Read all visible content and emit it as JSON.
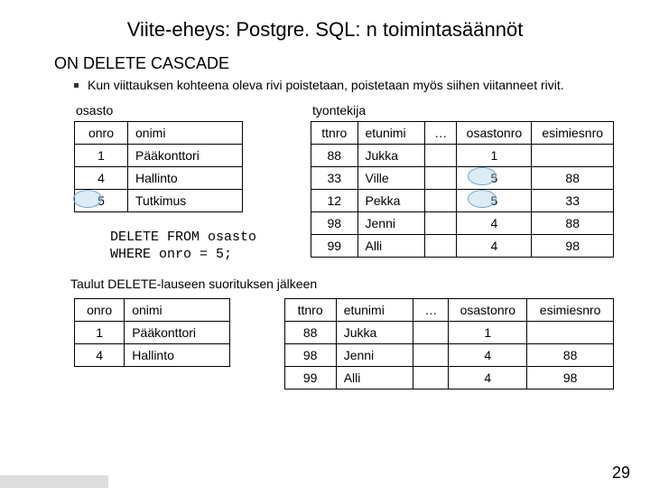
{
  "title": "Viite-eheys: Postgre. SQL: n toimintasäännöt",
  "subtitle": "ON DELETE CASCADE",
  "bullet": "Kun viittauksen kohteena oleva rivi poistetaan, poistetaan myös siihen viitanneet rivit.",
  "labels": {
    "osasto": "osasto",
    "tyontekija": "tyontekija",
    "after": "Taulut DELETE-lauseen suorituksen jälkeen"
  },
  "osasto_before": {
    "headers": [
      "onro",
      "onimi"
    ],
    "rows": [
      [
        "1",
        "Pääkonttori"
      ],
      [
        "4",
        "Hallinto"
      ],
      [
        "5",
        "Tutkimus"
      ]
    ]
  },
  "tyontekija_before": {
    "headers": [
      "ttnro",
      "etunimi",
      "…",
      "osastonro",
      "esimiesnro"
    ],
    "rows": [
      [
        "88",
        "Jukka",
        "",
        "1",
        ""
      ],
      [
        "33",
        "Ville",
        "",
        "5",
        "88"
      ],
      [
        "12",
        "Pekka",
        "",
        "5",
        "33"
      ],
      [
        "98",
        "Jenni",
        "",
        "4",
        "88"
      ],
      [
        "99",
        "Alli",
        "",
        "4",
        "98"
      ]
    ]
  },
  "sql": "DELETE FROM osasto\nWHERE onro = 5;",
  "osasto_after": {
    "headers": [
      "onro",
      "onimi"
    ],
    "rows": [
      [
        "1",
        "Pääkonttori"
      ],
      [
        "4",
        "Hallinto"
      ]
    ]
  },
  "tyontekija_after": {
    "headers": [
      "ttnro",
      "etunimi",
      "…",
      "osastonro",
      "esimiesnro"
    ],
    "rows": [
      [
        "88",
        "Jukka",
        "",
        "1",
        ""
      ],
      [
        "98",
        "Jenni",
        "",
        "4",
        "88"
      ],
      [
        "99",
        "Alli",
        "",
        "4",
        "98"
      ]
    ]
  },
  "pagenum": "29"
}
